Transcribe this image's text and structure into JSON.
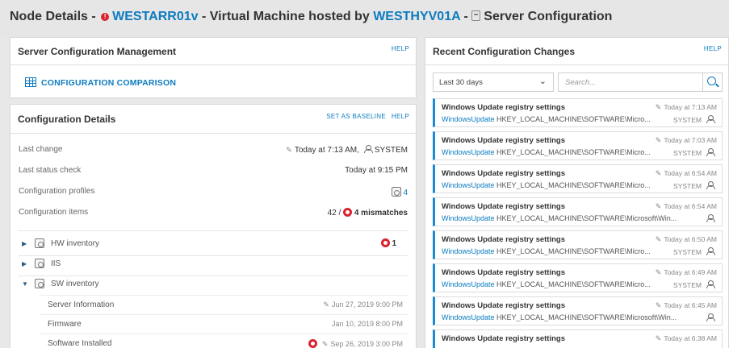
{
  "header": {
    "prefix": "Node Details -",
    "node_link": "WESTARR01v",
    "mid_text": "- Virtual Machine hosted by",
    "host_link": "WESTHYV01A",
    "dash": "-",
    "section": "Server Configuration"
  },
  "mgmt_panel": {
    "title": "Server Configuration Management",
    "help": "HELP",
    "comparison_link": "CONFIGURATION COMPARISON"
  },
  "details_panel": {
    "title": "Configuration Details",
    "set_baseline": "SET AS BASELINE",
    "help": "HELP",
    "rows": [
      {
        "label": "Last change",
        "time": "Today at 7:13 AM,",
        "user": "SYSTEM"
      },
      {
        "label": "Last status check",
        "value": "Today at 9:15 PM"
      },
      {
        "label": "Configuration profiles",
        "value": "4"
      },
      {
        "label": "Configuration items",
        "count": "42 /",
        "mismatches": "4 mismatches"
      }
    ],
    "tree": [
      {
        "label": "HW inventory",
        "badge": "1",
        "expanded": false
      },
      {
        "label": "IIS",
        "expanded": false
      },
      {
        "label": "SW inventory",
        "expanded": true
      }
    ],
    "sw_children": [
      {
        "label": "Server Information",
        "value": "Jun 27, 2019 9:00 PM"
      },
      {
        "label": "Firmware",
        "value": "Jan 10, 2019 8:00 PM"
      },
      {
        "label": "Software Installed",
        "value": "Sep 26, 2019 3:00 PM"
      }
    ]
  },
  "recent_panel": {
    "title": "Recent Configuration Changes",
    "help": "HELP",
    "filter_selected": "Last 30 days",
    "search_placeholder": "Search...",
    "items": [
      {
        "title": "Windows Update registry settings",
        "when": "Today at 7:13 AM",
        "source": "WindowsUpdate",
        "path": "HKEY_LOCAL_MACHINE\\SOFTWARE\\Micro...",
        "user": "SYSTEM"
      },
      {
        "title": "Windows Update registry settings",
        "when": "Today at 7:03 AM",
        "source": "WindowsUpdate",
        "path": "HKEY_LOCAL_MACHINE\\SOFTWARE\\Micro...",
        "user": "SYSTEM"
      },
      {
        "title": "Windows Update registry settings",
        "when": "Today at 6:54 AM",
        "source": "WindowsUpdate",
        "path": "HKEY_LOCAL_MACHINE\\SOFTWARE\\Micro...",
        "user": "SYSTEM"
      },
      {
        "title": "Windows Update registry settings",
        "when": "Today at 6:54 AM",
        "source": "WindowsUpdate",
        "path": "HKEY_LOCAL_MACHINE\\SOFTWARE\\Microsoft\\Win...",
        "user": ""
      },
      {
        "title": "Windows Update registry settings",
        "when": "Today at 6:50 AM",
        "source": "WindowsUpdate",
        "path": "HKEY_LOCAL_MACHINE\\SOFTWARE\\Micro...",
        "user": "SYSTEM"
      },
      {
        "title": "Windows Update registry settings",
        "when": "Today at 6:49 AM",
        "source": "WindowsUpdate",
        "path": "HKEY_LOCAL_MACHINE\\SOFTWARE\\Micro...",
        "user": "SYSTEM"
      },
      {
        "title": "Windows Update registry settings",
        "when": "Today at 6:45 AM",
        "source": "WindowsUpdate",
        "path": "HKEY_LOCAL_MACHINE\\SOFTWARE\\Microsoft\\Win...",
        "user": ""
      },
      {
        "title": "Windows Update registry settings",
        "when": "Today at 6:38 AM",
        "source": "",
        "path": "",
        "user": ""
      }
    ]
  },
  "colors": {
    "accent": "#0d7bbf",
    "alert": "#d9232e",
    "item_bar": "#1b8bd6"
  }
}
